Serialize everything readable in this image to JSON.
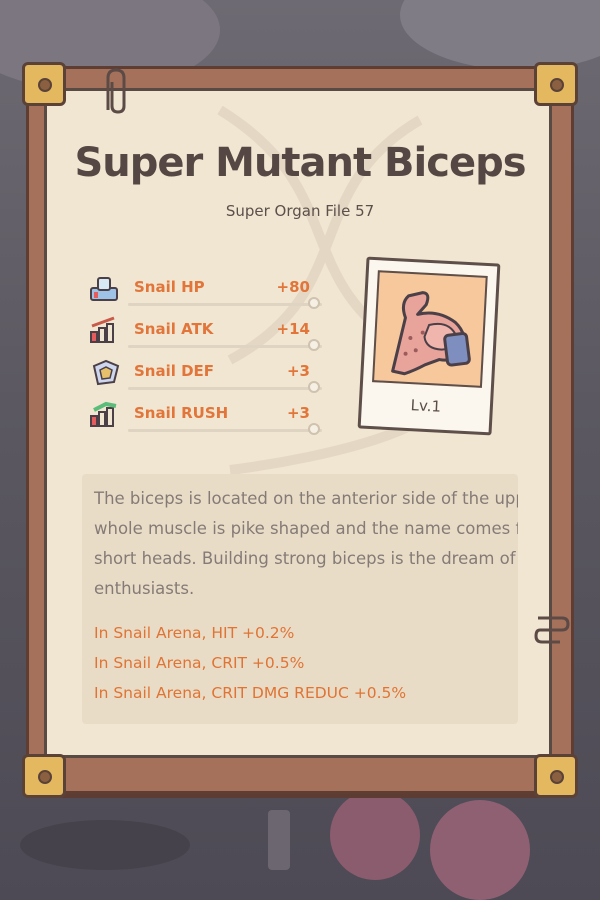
{
  "card": {
    "title": "Super Mutant Biceps",
    "subtitle": "Super Organ File 57"
  },
  "stats": [
    {
      "icon": "hp-icon",
      "name": "Snail HP",
      "value": "+80",
      "color": "#e1753a"
    },
    {
      "icon": "atk-icon",
      "name": "Snail ATK",
      "value": "+14",
      "color": "#e1753a"
    },
    {
      "icon": "def-icon",
      "name": "Snail DEF",
      "value": "+3",
      "color": "#e1753a"
    },
    {
      "icon": "rush-icon",
      "name": "Snail RUSH",
      "value": "+3",
      "color": "#e1753a"
    }
  ],
  "organ": {
    "image": "flexed-biceps-arm",
    "level": "Lv.1"
  },
  "description": {
    "lines": [
      "The biceps is located on the anterior side of the uppe",
      "whole muscle is pike shaped and the name comes fr",
      "short heads. Building strong biceps is the dream of n",
      "enthusiasts."
    ],
    "bonuses": [
      "In Snail Arena, HIT +0.2%",
      "In Snail Arena, CRIT +0.5%",
      "In Snail Arena, CRIT DMG REDUC +0.5%"
    ]
  },
  "colors": {
    "accent": "#e1753a",
    "paper": "#f1e6d1",
    "frame": "#a5715a",
    "corner": "#e4b85f",
    "text": "#544744"
  }
}
